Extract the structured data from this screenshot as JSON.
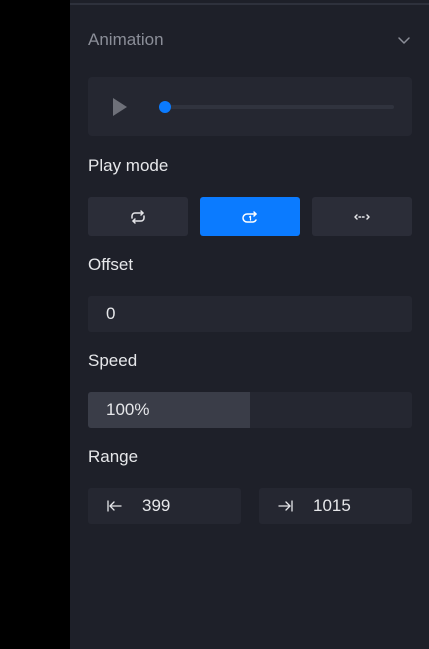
{
  "animation": {
    "title": "Animation",
    "collapse_icon": "chevron-down-icon",
    "player": {
      "play_icon": "play-icon",
      "progress": 0.02,
      "accent_color": "#0b7bff"
    },
    "play_mode": {
      "label": "Play mode",
      "options": [
        {
          "icon": "loop-icon",
          "active": false
        },
        {
          "icon": "play-once-icon",
          "active": true
        },
        {
          "icon": "ping-pong-icon",
          "active": false
        }
      ]
    },
    "offset": {
      "label": "Offset",
      "value": "0"
    },
    "speed": {
      "label": "Speed",
      "value": "100%",
      "fill_fraction": 0.5
    },
    "range": {
      "label": "Range",
      "start": {
        "icon": "range-start-icon",
        "value": "399"
      },
      "end": {
        "icon": "range-end-icon",
        "value": "1015"
      }
    }
  }
}
